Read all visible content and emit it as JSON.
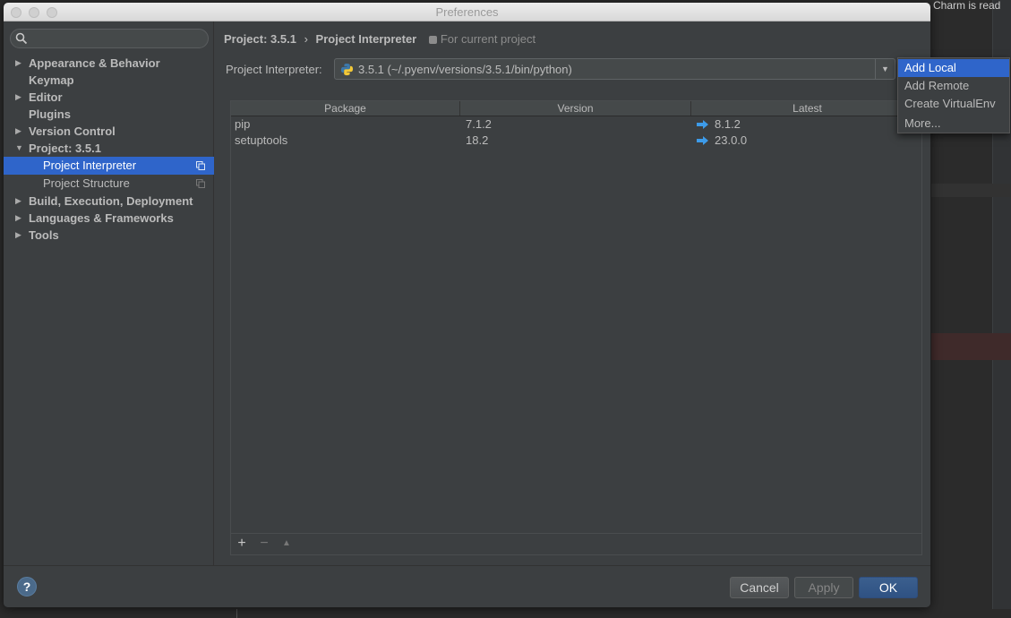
{
  "window": {
    "title": "Preferences"
  },
  "background": {
    "right_text": "Charm is read"
  },
  "sidebar": {
    "search_placeholder": "",
    "items": [
      {
        "label": "Appearance & Behavior",
        "expandable": true
      },
      {
        "label": "Keymap",
        "expandable": false
      },
      {
        "label": "Editor",
        "expandable": true
      },
      {
        "label": "Plugins",
        "expandable": false
      },
      {
        "label": "Version Control",
        "expandable": true
      },
      {
        "label": "Project: 3.5.1",
        "expandable": true,
        "expanded": true
      },
      {
        "label": "Project Interpreter",
        "child": true,
        "selected": true
      },
      {
        "label": "Project Structure",
        "child": true
      },
      {
        "label": "Build, Execution, Deployment",
        "expandable": true
      },
      {
        "label": "Languages & Frameworks",
        "expandable": true
      },
      {
        "label": "Tools",
        "expandable": true
      }
    ]
  },
  "breadcrumb": {
    "parent": "Project: 3.5.1",
    "separator": "›",
    "current": "Project Interpreter",
    "scope": "For current project"
  },
  "interpreter": {
    "label": "Project Interpreter:",
    "value": "3.5.1 (~/.pyenv/versions/3.5.1/bin/python)"
  },
  "packages": {
    "columns": [
      "Package",
      "Version",
      "Latest"
    ],
    "rows": [
      {
        "package": "pip",
        "version": "7.1.2",
        "latest": "8.1.2",
        "upgrade": true
      },
      {
        "package": "setuptools",
        "version": "18.2",
        "latest": "23.0.0",
        "upgrade": true
      }
    ]
  },
  "toolbar": {
    "add": "+",
    "remove": "−",
    "upgrade": "▲"
  },
  "dropdown": {
    "items": [
      "Add Local",
      "Add Remote",
      "Create VirtualEnv",
      "More..."
    ],
    "active_index": 0
  },
  "footer": {
    "help": "?",
    "cancel": "Cancel",
    "apply": "Apply",
    "ok": "OK"
  },
  "colors": {
    "selection": "#2f65ca",
    "panel": "#3c3f41",
    "text": "#bbbbbb",
    "upgrade_arrow": "#3d9be9"
  },
  "icons": {
    "search": "search-icon",
    "python": "python-icon",
    "upgrade": "upgrade-arrow-icon",
    "copy": "copy-settings-icon"
  }
}
